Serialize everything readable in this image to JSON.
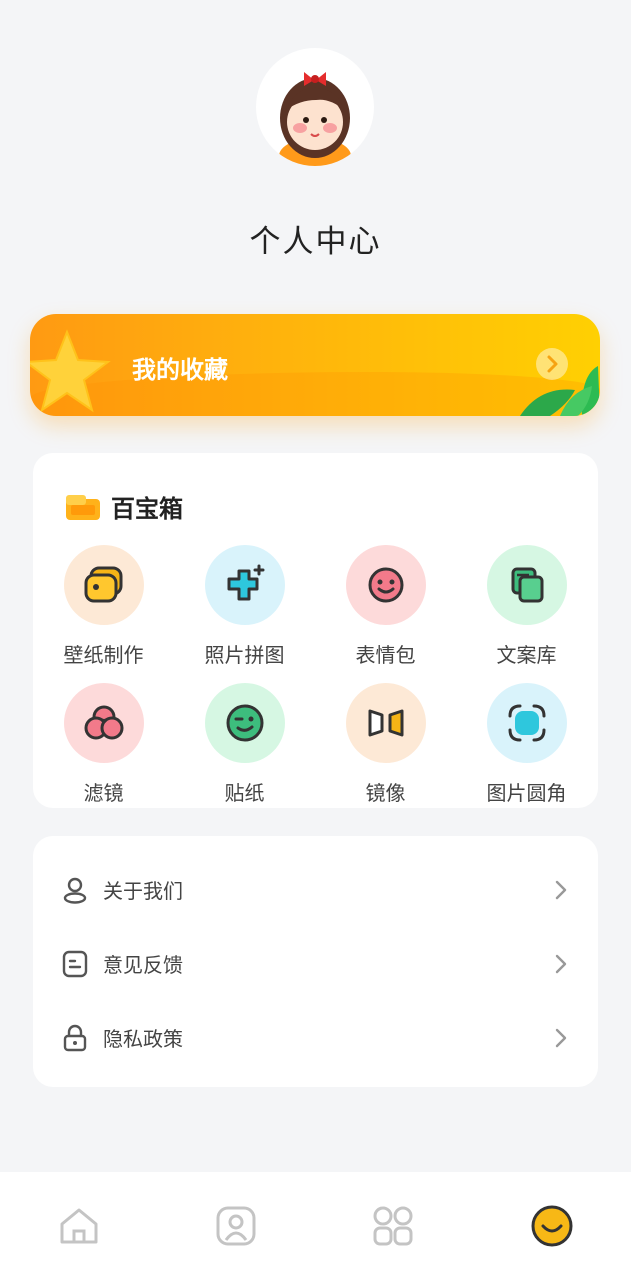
{
  "header": {
    "title": "个人中心",
    "avatar_icon": "girl-avatar-icon"
  },
  "favorites": {
    "label": "我的收藏"
  },
  "toolbox": {
    "title": "百宝箱",
    "items": [
      {
        "label": "壁纸制作",
        "icon": "wallpaper-icon",
        "bg": "#fde9d6",
        "color": "#f6b416"
      },
      {
        "label": "照片拼图",
        "icon": "puzzle-icon",
        "bg": "#d9f3fb",
        "color": "#2ec7dd"
      },
      {
        "label": "表情包",
        "icon": "emoji-icon",
        "bg": "#fddada",
        "color": "#f27a8a"
      },
      {
        "label": "文案库",
        "icon": "copy-library-icon",
        "bg": "#d6f7e3",
        "color": "#3dbd7d"
      },
      {
        "label": "滤镜",
        "icon": "filter-icon",
        "bg": "#fddada",
        "color": "#f27a8a"
      },
      {
        "label": "贴纸",
        "icon": "sticker-icon",
        "bg": "#d6f7e3",
        "color": "#3dbd7d"
      },
      {
        "label": "镜像",
        "icon": "mirror-icon",
        "bg": "#fde9d6",
        "color": "#f6b416"
      },
      {
        "label": "图片圆角",
        "icon": "round-corner-icon",
        "bg": "#d9f3fb",
        "color": "#2ec7dd"
      }
    ]
  },
  "menu": {
    "items": [
      {
        "label": "关于我们",
        "icon": "user-icon"
      },
      {
        "label": "意见反馈",
        "icon": "feedback-icon"
      },
      {
        "label": "隐私政策",
        "icon": "lock-icon"
      }
    ]
  },
  "tabbar": {
    "tabs": [
      {
        "icon": "home-icon",
        "active": false
      },
      {
        "icon": "portrait-icon",
        "active": false
      },
      {
        "icon": "apps-grid-icon",
        "active": false
      },
      {
        "icon": "smile-profile-icon",
        "active": true
      }
    ],
    "active_color": "#f7b816",
    "inactive_color": "#c4c4c4"
  }
}
